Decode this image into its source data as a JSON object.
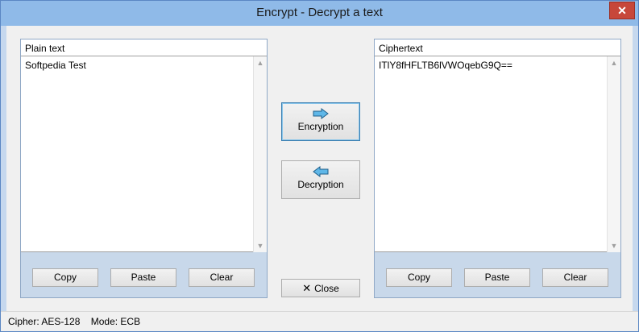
{
  "window": {
    "title": "Encrypt - Decrypt a text",
    "close_glyph": "✕"
  },
  "plain": {
    "header": "Plain text",
    "value": "Softpedia Test",
    "buttons": {
      "copy": "Copy",
      "paste": "Paste",
      "clear": "Clear"
    }
  },
  "cipher": {
    "header": "Ciphertext",
    "value": "ITlY8fHFLTB6lVWOqebG9Q==",
    "buttons": {
      "copy": "Copy",
      "paste": "Paste",
      "clear": "Clear"
    }
  },
  "actions": {
    "encrypt_label": "Encryption",
    "decrypt_label": "Decryption",
    "close_label": "Close",
    "close_glyph": "✕"
  },
  "status": {
    "cipher": "Cipher: AES-128",
    "mode": "Mode: ECB"
  },
  "colors": {
    "arrow_fill": "#5fb7e8",
    "arrow_stroke": "#1f5f8a"
  },
  "icons": {
    "encrypt": "right-arrow-icon",
    "decrypt": "left-arrow-icon",
    "close": "x-icon"
  }
}
